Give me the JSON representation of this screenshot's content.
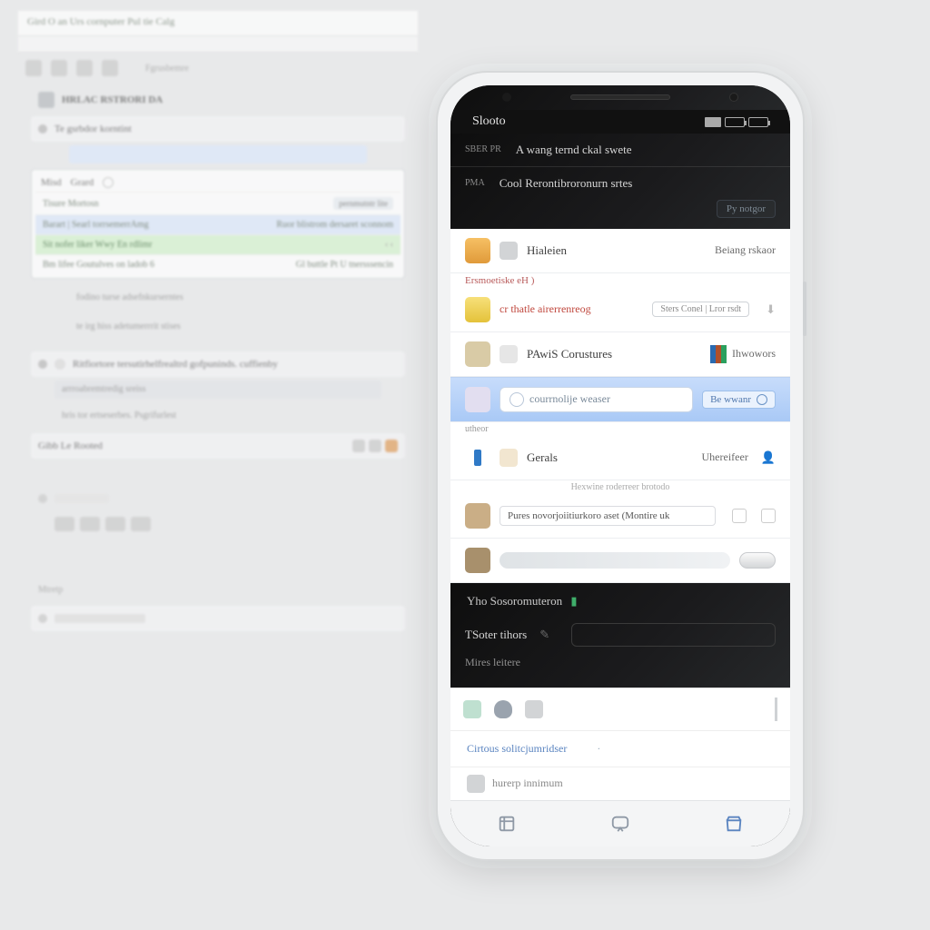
{
  "desktop": {
    "title": "Gird O an Urs cornputer Pul tie Calg",
    "section_label": "Fgrusbemre",
    "heading": "HRLAC RSTRORI DA",
    "bullet_row": "Te gsrbdor korntint",
    "box": {
      "tab1": "Misd",
      "tab2": "Grard",
      "row1": "Tisure Mortosn",
      "row1_right": "pernmutntr lite",
      "row2_left": "Barart | Searl torrsemerrAmg",
      "row2_right": "Ruor blistrom dersaret sconnom",
      "green_row": "Sit nofer liker Wwy En rdlimr",
      "bottom_left": "Bm lifee   Goutulves on ladob  6",
      "bottom_right": "Gl buttle  Pt U tnersssencin"
    },
    "para1": "fodino turse adsefnkurserntes",
    "para2": "te irg hiss adetumerrrit stises",
    "bullet2": "Ritfiortore tersutirhelfrealtrd gofpuninds. cuffienby",
    "bar1": "arrroabremtredig sreiss",
    "bar2": "hris tor ertseserbes. Psgrifurlest",
    "bar3": "Gibb Le Rooted"
  },
  "phone": {
    "status_time": "Slooto",
    "header1": {
      "tag": "SBER PR",
      "text": "A wang ternd ckal swete"
    },
    "header2": {
      "tag": "PMA",
      "text": "Cool Rerontibroronurn srtes"
    },
    "header2_button": "Py notgor",
    "list": {
      "r1": {
        "label": "Hialeien",
        "right": "Beiang rskaor"
      },
      "r1_sub": "Ersmoetiske  eH )",
      "r2": {
        "label": "cr thatle airerrenreog",
        "chip": "Sters Conel | Lror rsdt"
      },
      "r3": {
        "label": "PAwiS Corustures",
        "right": "Ihwowors"
      },
      "selected_placeholder": "courrnolije weaser",
      "selected_chip": "Be wwanr",
      "r4_tiny": "utheor",
      "r5": {
        "label": "Gerals",
        "right": "Uhereifeer"
      },
      "r5_sub": "Hexwine roderreer  brotodo",
      "r6": {
        "label": "Pures novorjoiitiurkoro aset (Montire uk"
      }
    },
    "dark_section": {
      "title": "Yho Sosoromuteron",
      "field_label": "TSoter tihors",
      "line2": "Mires leitere"
    },
    "footer": {
      "link": "Cirtous solitcjumridser",
      "gray": "hurerp innimum"
    }
  }
}
